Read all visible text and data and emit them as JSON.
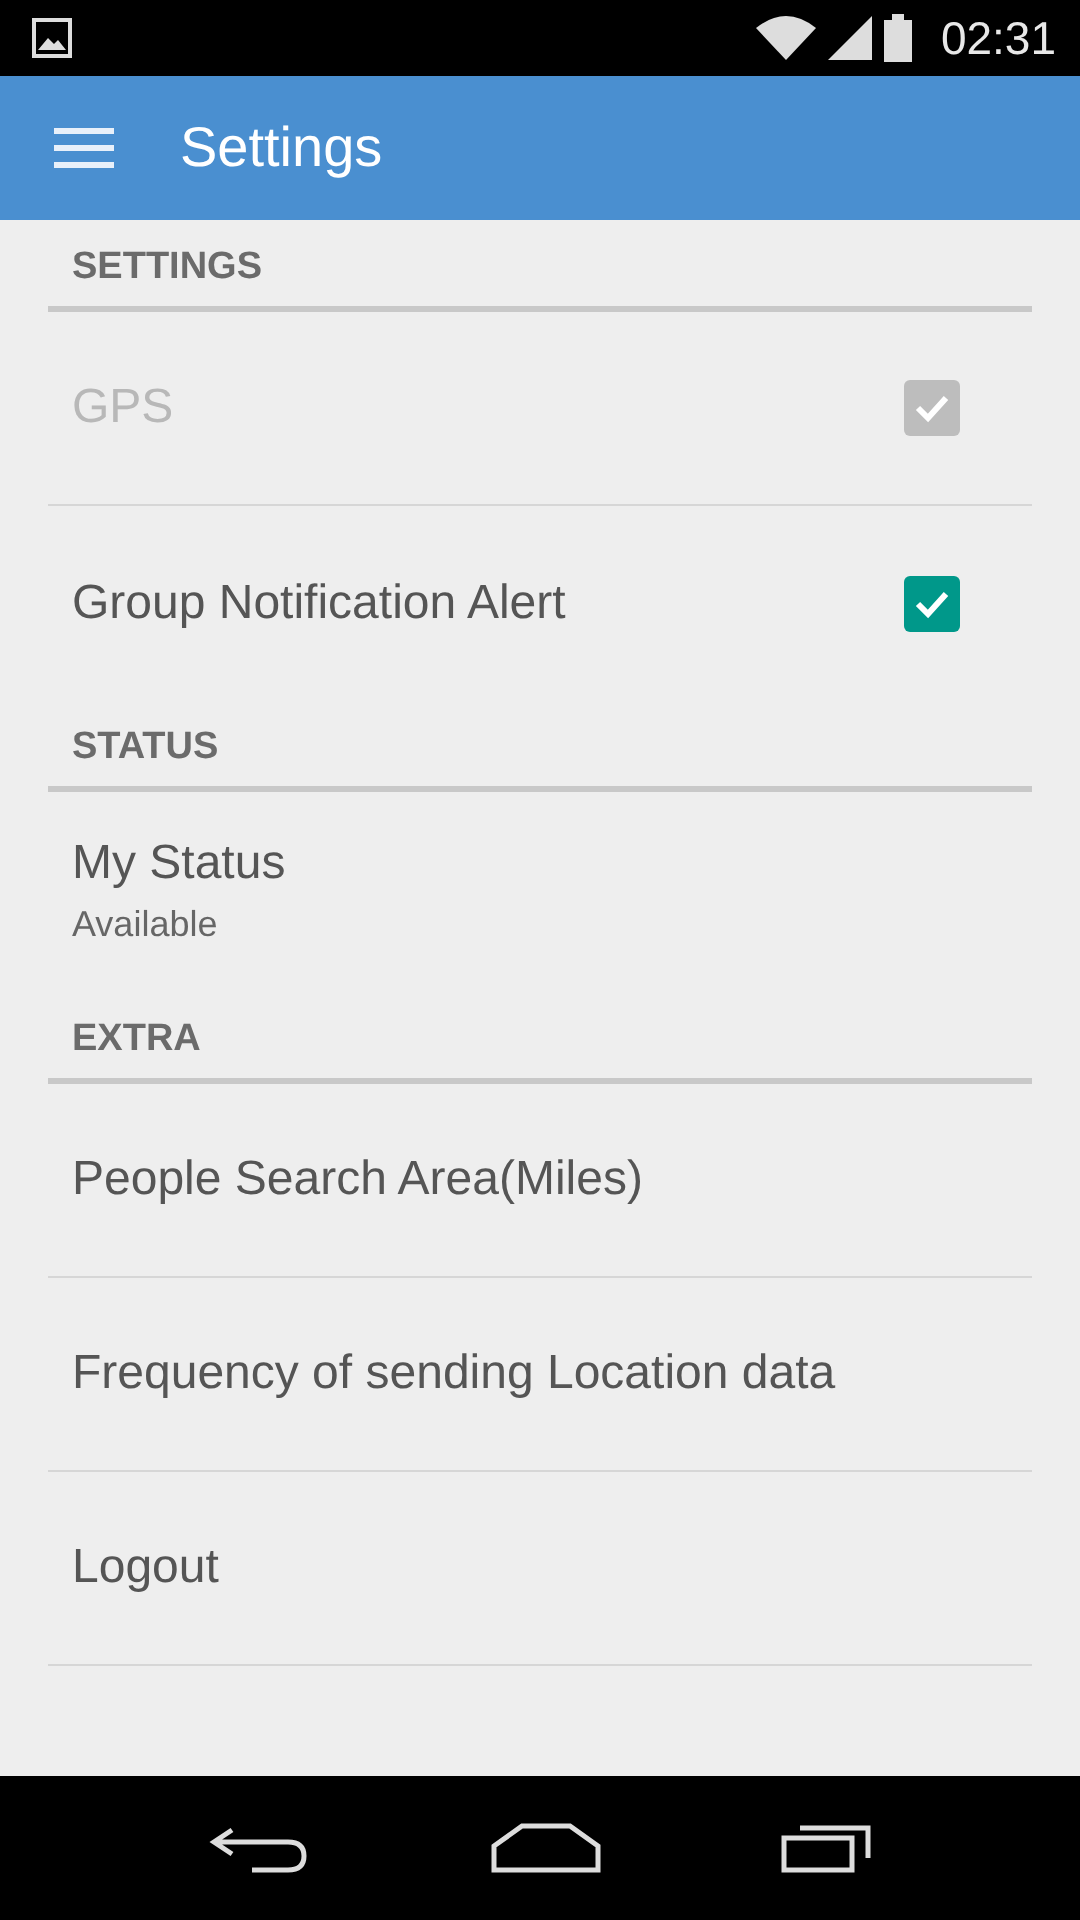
{
  "status_bar": {
    "time": "02:31"
  },
  "app_bar": {
    "title": "Settings"
  },
  "sections": [
    {
      "title": "SETTINGS",
      "items": [
        {
          "kind": "checkbox",
          "title": "GPS",
          "disabled": true,
          "checked": true
        },
        {
          "kind": "checkbox",
          "title": "Group Notification Alert",
          "disabled": false,
          "checked": true
        }
      ]
    },
    {
      "title": "STATUS",
      "items": [
        {
          "kind": "summary",
          "title": "My Status",
          "summary": "Available",
          "disabled": false
        }
      ]
    },
    {
      "title": "EXTRA",
      "items": [
        {
          "kind": "plain",
          "title": "People Search Area(Miles)",
          "disabled": false
        },
        {
          "kind": "plain",
          "title": "Frequency of sending Location data",
          "disabled": false
        },
        {
          "kind": "plain",
          "title": "Logout",
          "disabled": false
        }
      ]
    }
  ]
}
